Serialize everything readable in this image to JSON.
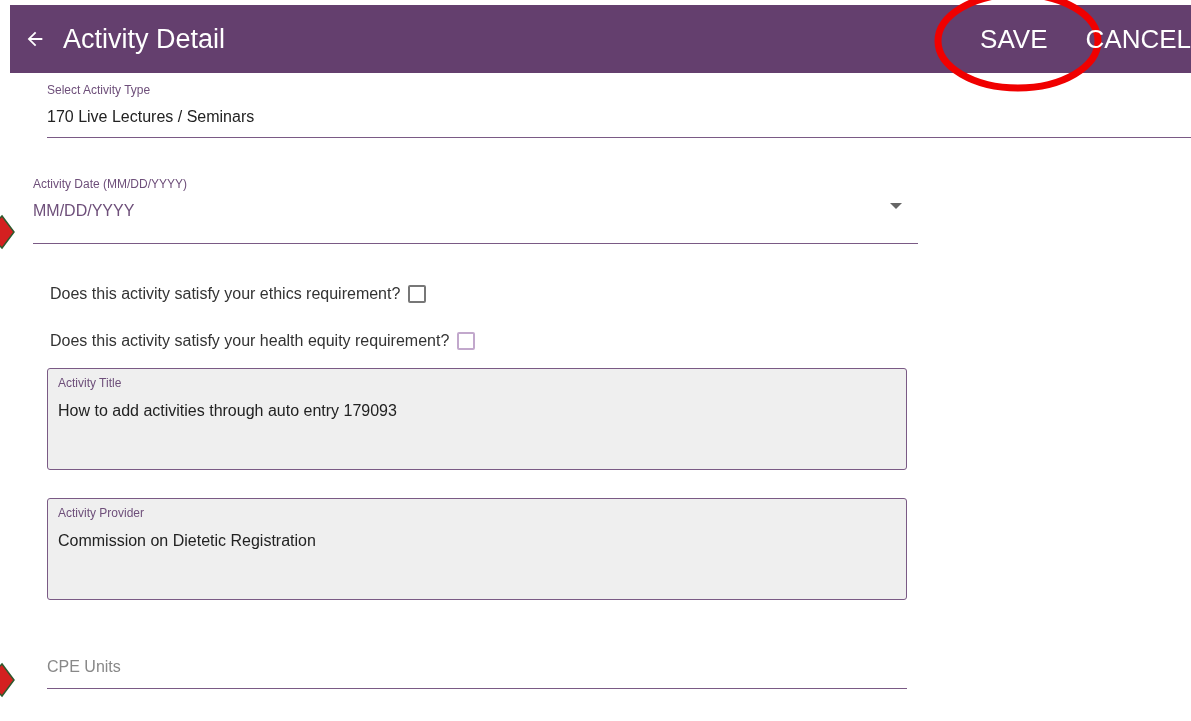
{
  "header": {
    "title": "Activity Detail",
    "actions": [
      {
        "label": "SAVE",
        "highlighted": true
      },
      {
        "label": "CANCEL",
        "highlighted": false
      }
    ]
  },
  "activity_type": {
    "label": "Select Activity Type",
    "value": "170 Live Lectures / Seminars"
  },
  "activity_date": {
    "label": "Activity Date (MM/DD/YYYY)",
    "placeholder": "MM/DD/YYYY",
    "flagged": true
  },
  "questions": [
    {
      "text": "Does this activity satisfy your ethics requirement?",
      "checked": false,
      "color": "#777777"
    },
    {
      "text": "Does this activity satisfy your health equity requirement?",
      "checked": false,
      "color": "#c2a8cc"
    }
  ],
  "activity_title": {
    "label": "Activity Title",
    "value": "How to add activities through auto entry 179093"
  },
  "activity_provider": {
    "label": "Activity Provider",
    "value": "Commission on Dietetic Registration"
  },
  "cpe_units": {
    "placeholder": "CPE Units",
    "flagged": true
  }
}
